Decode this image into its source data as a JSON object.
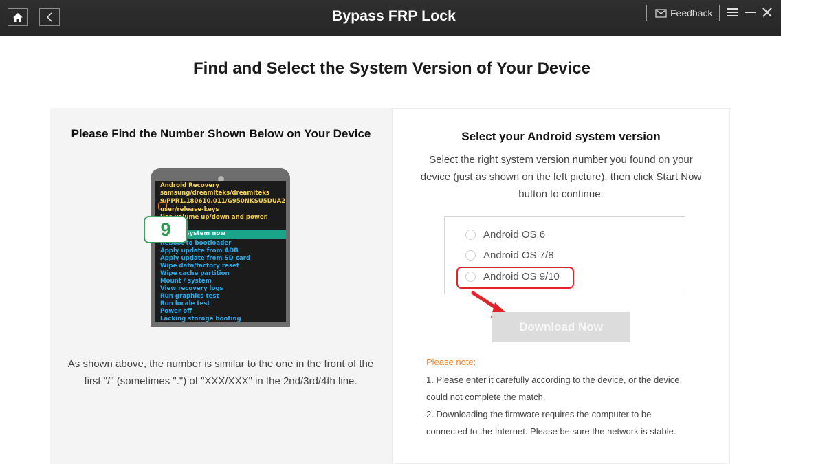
{
  "app": {
    "title": "Bypass FRP Lock",
    "feedback_label": "Feedback"
  },
  "page": {
    "title": "Find and Select the System Version of Your Device"
  },
  "left": {
    "title": "Please Find the Number Shown Below on Your Device",
    "recovery_lines": [
      "Android Recovery",
      "samsung/dreamlteks/dreamlteks",
      "9/PPR1.180610.011/G950NKSU5DUA2",
      "user/release-keys",
      "Use volume up/down and power.",
      "Reboot system now",
      "Reboot to bootloader",
      "Apply update from ADB",
      "Apply update from SD card",
      "Wipe data/factory reset",
      "Wipe cache partition",
      "Mount / system",
      "View recovery logs",
      "Run graphics test",
      "Run locale test",
      "Power off",
      "Lacking storage booting"
    ],
    "badge_number": "9",
    "description": "As shown above, the number is similar to the one in the front of the first \"/\" (sometimes \".\") of \"XXX/XXX\" in the 2nd/3rd/4th line."
  },
  "right": {
    "title": "Select your Android system version",
    "description": "Select the right system version number you found on your device (just as shown on the left picture), then click Start Now button to continue.",
    "options": [
      "Android OS 6",
      "Android OS 7/8",
      "Android OS 9/10"
    ],
    "highlighted_option": "Android OS 9/10",
    "download_label": "Download Now",
    "note_title": "Please note:",
    "note_1a": "1. Please enter it carefully according to the device, or the device",
    "note_1b": "could not complete the match.",
    "note_2a": "2. Downloading the firmware requires the computer to be",
    "note_2b": "connected to the Internet. Please be sure the network is stable."
  },
  "colors": {
    "accent_green": "#2d9a50",
    "highlight_red": "#e0242b",
    "note_orange": "#f0882d",
    "titlebar": "#2b2b2b"
  },
  "icons": [
    "home-icon",
    "back-arrow-icon",
    "mail-icon",
    "menu-icon",
    "minimize-icon",
    "close-icon",
    "red-arrow-icon"
  ]
}
